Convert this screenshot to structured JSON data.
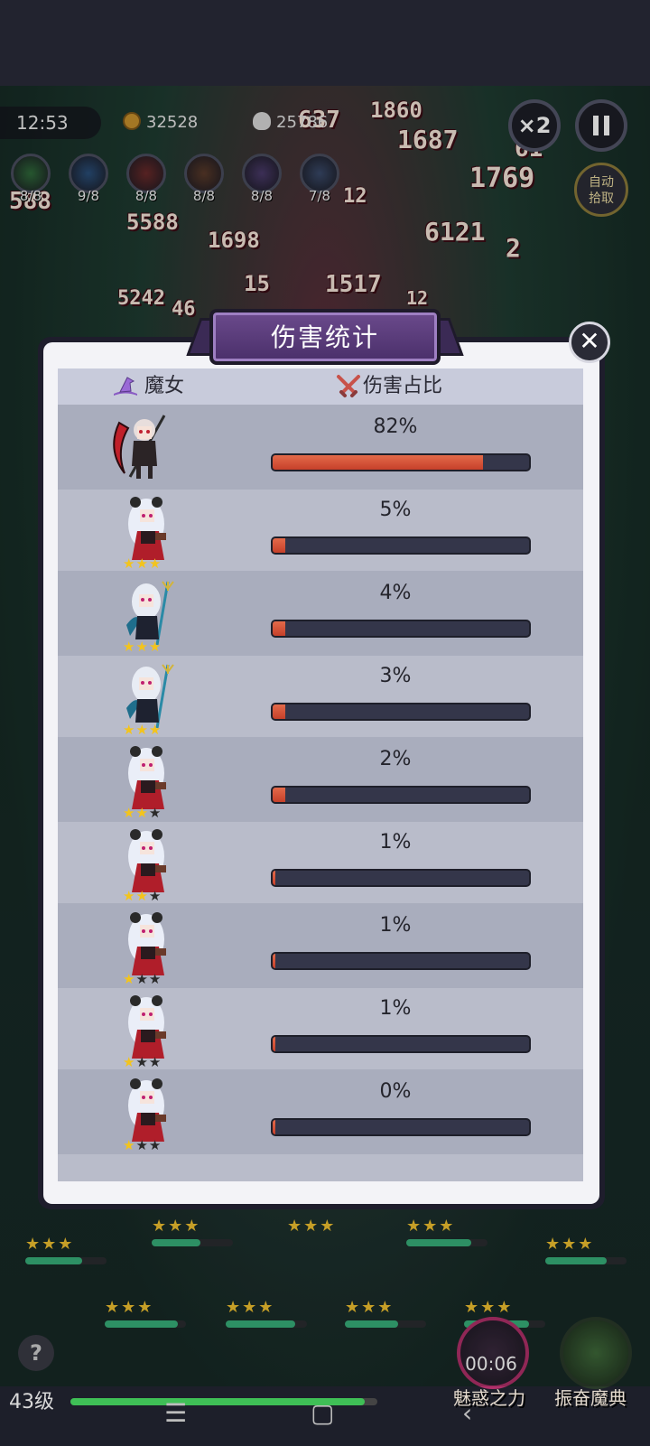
{
  "hud": {
    "time": "12:53",
    "coins": "32528",
    "kills": "25786",
    "speed": "×2",
    "auto_pickup": "自动拾取",
    "skills": [
      {
        "name": "feather-skill-icon",
        "count": "8/8",
        "color": "#2f6a3a"
      },
      {
        "name": "wand-skill-icon",
        "count": "9/8",
        "color": "#2a4f7a"
      },
      {
        "name": "scythe-skill-icon",
        "count": "8/8",
        "color": "#6a2a2a"
      },
      {
        "name": "whirl-skill-icon",
        "count": "8/8",
        "color": "#5a3a2a"
      },
      {
        "name": "rune-skill-icon",
        "count": "8/8",
        "color": "#4a3a6a"
      },
      {
        "name": "wing-skill-icon",
        "count": "7/8",
        "color": "#3a4a6a"
      }
    ]
  },
  "damage_numbers": [
    "637",
    "1860",
    "1687",
    "588",
    "5588",
    "1698",
    "6121",
    "1769",
    "12",
    "15",
    "1517",
    "5242",
    "46",
    "61",
    "2",
    "12"
  ],
  "dialog": {
    "title": "伤害统计",
    "col_witch": "魔女",
    "col_share": "伤害占比",
    "rows": [
      {
        "pct": "82%",
        "fraction": 0.82,
        "stars": 0,
        "hero": "scythe-witch"
      },
      {
        "pct": "5%",
        "fraction": 0.05,
        "stars": 3,
        "hero": "silver-witch"
      },
      {
        "pct": "4%",
        "fraction": 0.04,
        "stars": 3,
        "hero": "trident-witch"
      },
      {
        "pct": "3%",
        "fraction": 0.03,
        "stars": 3,
        "hero": "trident-witch"
      },
      {
        "pct": "2%",
        "fraction": 0.02,
        "stars": 2,
        "hero": "silver-witch"
      },
      {
        "pct": "1%",
        "fraction": 0.01,
        "stars": 2,
        "hero": "silver-witch"
      },
      {
        "pct": "1%",
        "fraction": 0.01,
        "stars": 1,
        "hero": "silver-witch"
      },
      {
        "pct": "1%",
        "fraction": 0.01,
        "stars": 1,
        "hero": "silver-witch"
      },
      {
        "pct": "0%",
        "fraction": 0.0,
        "stars": 1,
        "hero": "silver-witch"
      }
    ]
  },
  "bottom": {
    "level": "43级",
    "xp_fraction": 0.96,
    "timer": "00:06",
    "skill1": "魅惑之力",
    "skill2": "振奋魔典",
    "help": "?"
  },
  "colors": {
    "bar_fill": "#d9503a",
    "bar_track": "#34364a",
    "star": "#f3c41c",
    "panel_frame": "#f3f3f7",
    "title_banner": "#5b3c7c"
  }
}
